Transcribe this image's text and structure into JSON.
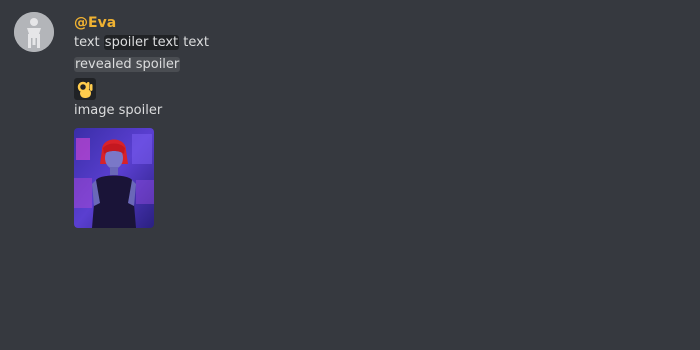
{
  "message": {
    "username": "@Eva",
    "line1": {
      "before": "text ",
      "spoiler": "spoiler text",
      "after": " text"
    },
    "revealed_spoiler": "revealed spoiler",
    "emoji": "ok-hand-emoji",
    "image_label": "image spoiler"
  },
  "colors": {
    "background": "#36393f",
    "username": "#f0b232",
    "text": "#dcddde",
    "spoiler_bg": "#202225"
  },
  "icons": {
    "avatar": "avatar-figure-icon",
    "emoji": "ok-hand-icon"
  }
}
